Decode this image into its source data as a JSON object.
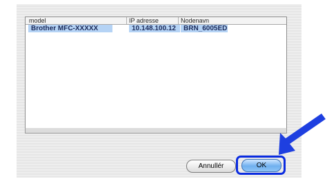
{
  "columns": [
    "model",
    "IP adresse",
    "Nodenavn"
  ],
  "rows": [
    {
      "model": "Brother MFC-XXXXX",
      "ip": "10.148.100.12",
      "node": "BRN_6005ED"
    }
  ],
  "buttons": {
    "cancel": "Annullér",
    "ok": "OK"
  },
  "colors": {
    "selection": "#b5d3f5",
    "focus_ring": "#0a2be0",
    "arrow": "#1e3fe0",
    "ok_button": "#6fb0ef"
  },
  "icons": {
    "pointer": "arrow-pointer-icon"
  }
}
